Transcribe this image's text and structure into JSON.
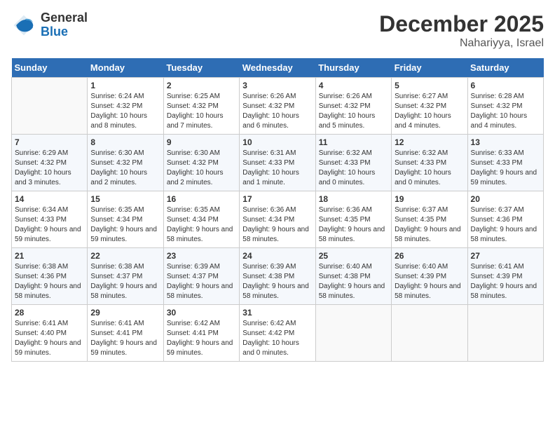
{
  "logo": {
    "line1": "General",
    "line2": "Blue"
  },
  "title": "December 2025",
  "subtitle": "Nahariyya, Israel",
  "weekdays": [
    "Sunday",
    "Monday",
    "Tuesday",
    "Wednesday",
    "Thursday",
    "Friday",
    "Saturday"
  ],
  "weeks": [
    [
      {
        "day": "",
        "sunrise": "",
        "sunset": "",
        "daylight": ""
      },
      {
        "day": "1",
        "sunrise": "Sunrise: 6:24 AM",
        "sunset": "Sunset: 4:32 PM",
        "daylight": "Daylight: 10 hours and 8 minutes."
      },
      {
        "day": "2",
        "sunrise": "Sunrise: 6:25 AM",
        "sunset": "Sunset: 4:32 PM",
        "daylight": "Daylight: 10 hours and 7 minutes."
      },
      {
        "day": "3",
        "sunrise": "Sunrise: 6:26 AM",
        "sunset": "Sunset: 4:32 PM",
        "daylight": "Daylight: 10 hours and 6 minutes."
      },
      {
        "day": "4",
        "sunrise": "Sunrise: 6:26 AM",
        "sunset": "Sunset: 4:32 PM",
        "daylight": "Daylight: 10 hours and 5 minutes."
      },
      {
        "day": "5",
        "sunrise": "Sunrise: 6:27 AM",
        "sunset": "Sunset: 4:32 PM",
        "daylight": "Daylight: 10 hours and 4 minutes."
      },
      {
        "day": "6",
        "sunrise": "Sunrise: 6:28 AM",
        "sunset": "Sunset: 4:32 PM",
        "daylight": "Daylight: 10 hours and 4 minutes."
      }
    ],
    [
      {
        "day": "7",
        "sunrise": "Sunrise: 6:29 AM",
        "sunset": "Sunset: 4:32 PM",
        "daylight": "Daylight: 10 hours and 3 minutes."
      },
      {
        "day": "8",
        "sunrise": "Sunrise: 6:30 AM",
        "sunset": "Sunset: 4:32 PM",
        "daylight": "Daylight: 10 hours and 2 minutes."
      },
      {
        "day": "9",
        "sunrise": "Sunrise: 6:30 AM",
        "sunset": "Sunset: 4:32 PM",
        "daylight": "Daylight: 10 hours and 2 minutes."
      },
      {
        "day": "10",
        "sunrise": "Sunrise: 6:31 AM",
        "sunset": "Sunset: 4:33 PM",
        "daylight": "Daylight: 10 hours and 1 minute."
      },
      {
        "day": "11",
        "sunrise": "Sunrise: 6:32 AM",
        "sunset": "Sunset: 4:33 PM",
        "daylight": "Daylight: 10 hours and 0 minutes."
      },
      {
        "day": "12",
        "sunrise": "Sunrise: 6:32 AM",
        "sunset": "Sunset: 4:33 PM",
        "daylight": "Daylight: 10 hours and 0 minutes."
      },
      {
        "day": "13",
        "sunrise": "Sunrise: 6:33 AM",
        "sunset": "Sunset: 4:33 PM",
        "daylight": "Daylight: 9 hours and 59 minutes."
      }
    ],
    [
      {
        "day": "14",
        "sunrise": "Sunrise: 6:34 AM",
        "sunset": "Sunset: 4:33 PM",
        "daylight": "Daylight: 9 hours and 59 minutes."
      },
      {
        "day": "15",
        "sunrise": "Sunrise: 6:35 AM",
        "sunset": "Sunset: 4:34 PM",
        "daylight": "Daylight: 9 hours and 59 minutes."
      },
      {
        "day": "16",
        "sunrise": "Sunrise: 6:35 AM",
        "sunset": "Sunset: 4:34 PM",
        "daylight": "Daylight: 9 hours and 58 minutes."
      },
      {
        "day": "17",
        "sunrise": "Sunrise: 6:36 AM",
        "sunset": "Sunset: 4:34 PM",
        "daylight": "Daylight: 9 hours and 58 minutes."
      },
      {
        "day": "18",
        "sunrise": "Sunrise: 6:36 AM",
        "sunset": "Sunset: 4:35 PM",
        "daylight": "Daylight: 9 hours and 58 minutes."
      },
      {
        "day": "19",
        "sunrise": "Sunrise: 6:37 AM",
        "sunset": "Sunset: 4:35 PM",
        "daylight": "Daylight: 9 hours and 58 minutes."
      },
      {
        "day": "20",
        "sunrise": "Sunrise: 6:37 AM",
        "sunset": "Sunset: 4:36 PM",
        "daylight": "Daylight: 9 hours and 58 minutes."
      }
    ],
    [
      {
        "day": "21",
        "sunrise": "Sunrise: 6:38 AM",
        "sunset": "Sunset: 4:36 PM",
        "daylight": "Daylight: 9 hours and 58 minutes."
      },
      {
        "day": "22",
        "sunrise": "Sunrise: 6:38 AM",
        "sunset": "Sunset: 4:37 PM",
        "daylight": "Daylight: 9 hours and 58 minutes."
      },
      {
        "day": "23",
        "sunrise": "Sunrise: 6:39 AM",
        "sunset": "Sunset: 4:37 PM",
        "daylight": "Daylight: 9 hours and 58 minutes."
      },
      {
        "day": "24",
        "sunrise": "Sunrise: 6:39 AM",
        "sunset": "Sunset: 4:38 PM",
        "daylight": "Daylight: 9 hours and 58 minutes."
      },
      {
        "day": "25",
        "sunrise": "Sunrise: 6:40 AM",
        "sunset": "Sunset: 4:38 PM",
        "daylight": "Daylight: 9 hours and 58 minutes."
      },
      {
        "day": "26",
        "sunrise": "Sunrise: 6:40 AM",
        "sunset": "Sunset: 4:39 PM",
        "daylight": "Daylight: 9 hours and 58 minutes."
      },
      {
        "day": "27",
        "sunrise": "Sunrise: 6:41 AM",
        "sunset": "Sunset: 4:39 PM",
        "daylight": "Daylight: 9 hours and 58 minutes."
      }
    ],
    [
      {
        "day": "28",
        "sunrise": "Sunrise: 6:41 AM",
        "sunset": "Sunset: 4:40 PM",
        "daylight": "Daylight: 9 hours and 59 minutes."
      },
      {
        "day": "29",
        "sunrise": "Sunrise: 6:41 AM",
        "sunset": "Sunset: 4:41 PM",
        "daylight": "Daylight: 9 hours and 59 minutes."
      },
      {
        "day": "30",
        "sunrise": "Sunrise: 6:42 AM",
        "sunset": "Sunset: 4:41 PM",
        "daylight": "Daylight: 9 hours and 59 minutes."
      },
      {
        "day": "31",
        "sunrise": "Sunrise: 6:42 AM",
        "sunset": "Sunset: 4:42 PM",
        "daylight": "Daylight: 10 hours and 0 minutes."
      },
      {
        "day": "",
        "sunrise": "",
        "sunset": "",
        "daylight": ""
      },
      {
        "day": "",
        "sunrise": "",
        "sunset": "",
        "daylight": ""
      },
      {
        "day": "",
        "sunrise": "",
        "sunset": "",
        "daylight": ""
      }
    ]
  ]
}
